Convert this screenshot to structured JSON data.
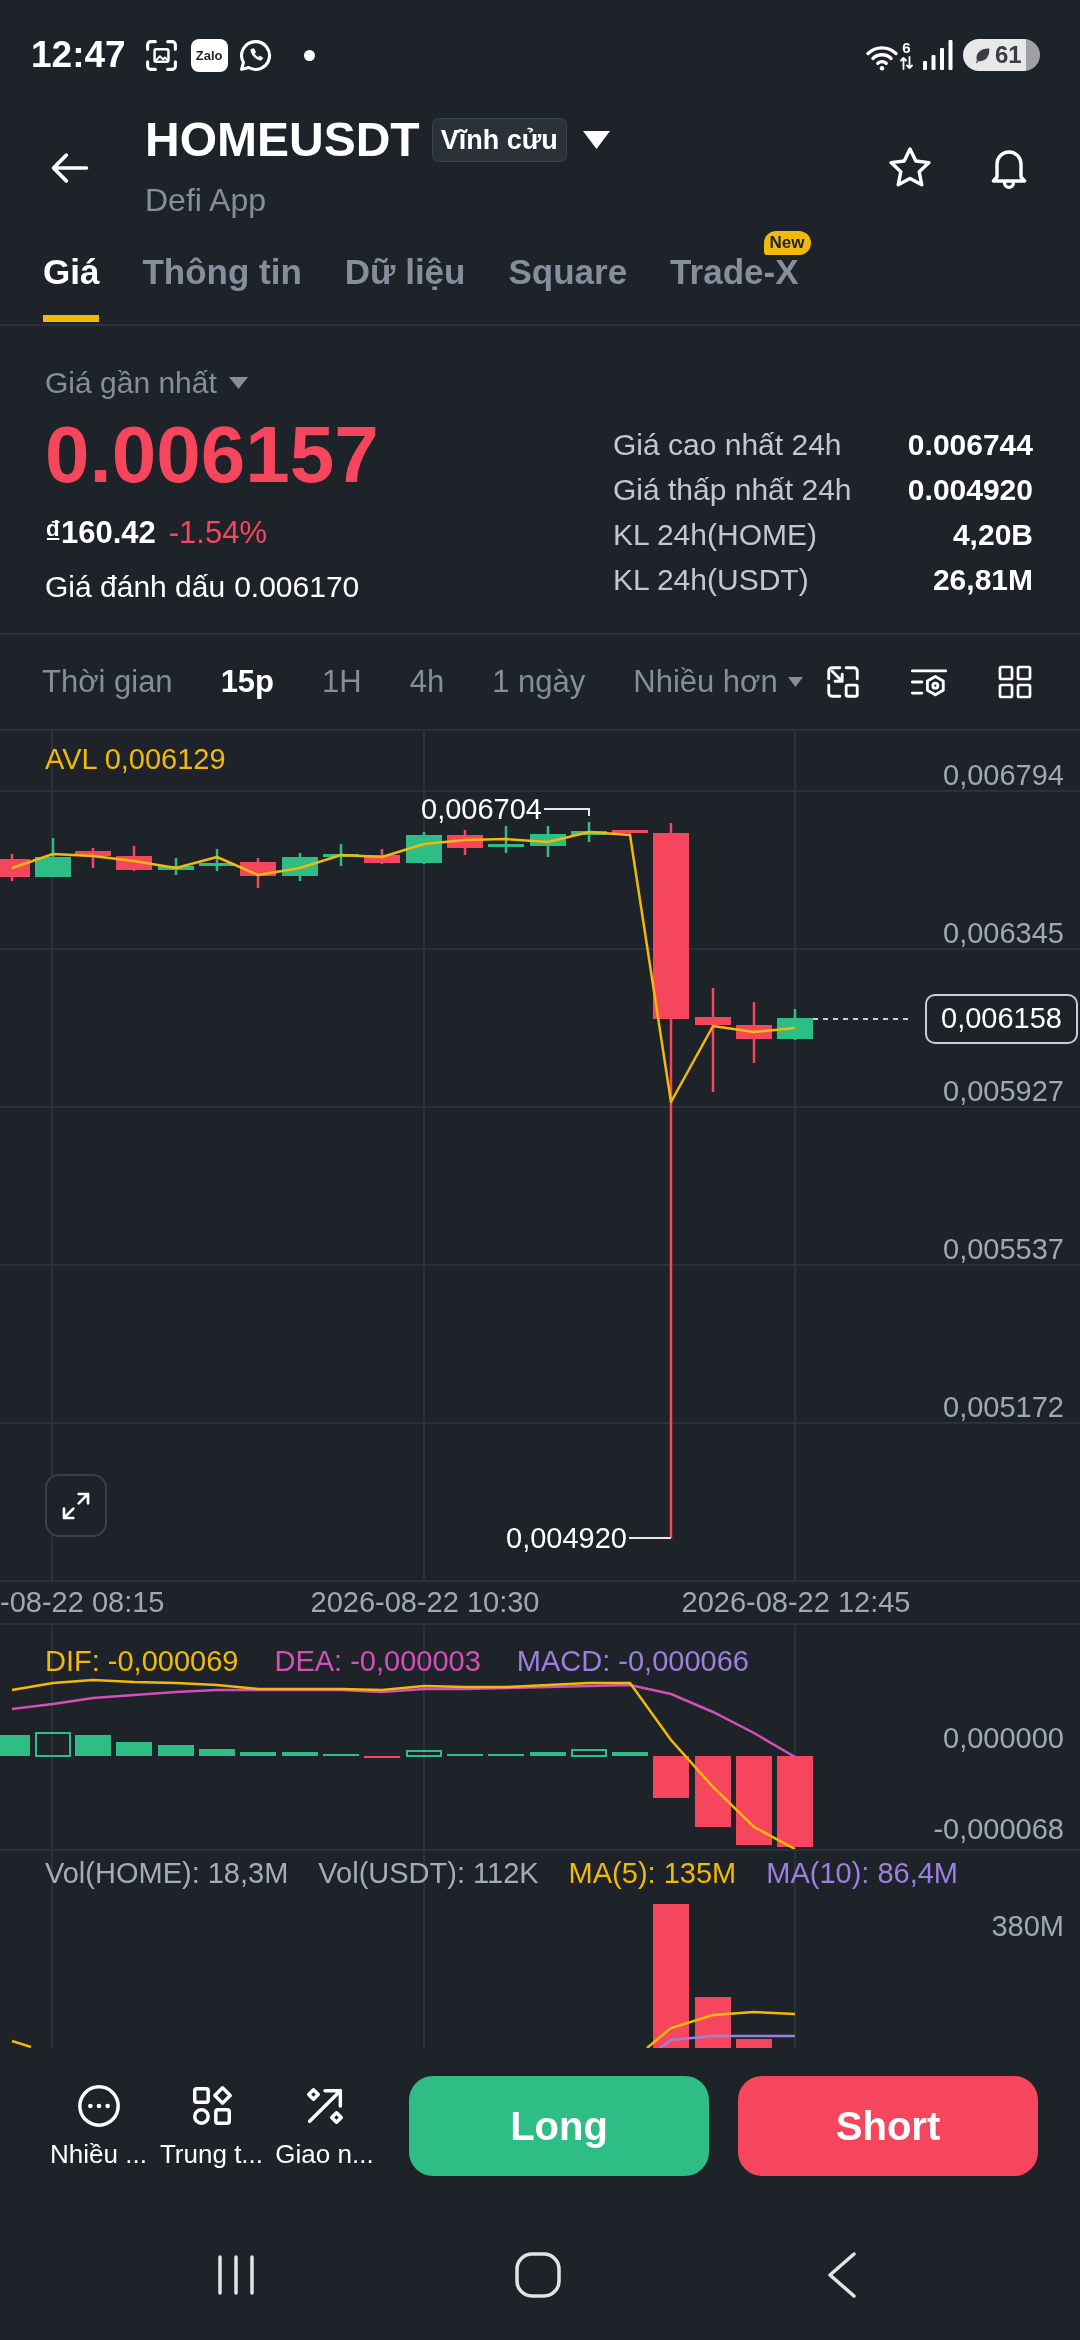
{
  "status_bar": {
    "time": "12:47",
    "app_badge": "Zalo",
    "network_type": "6",
    "battery": "61"
  },
  "header": {
    "symbol": "HOMEUSDT",
    "contract_type": "Vĩnh cửu",
    "subtitle": "Defi App"
  },
  "tabs": [
    {
      "label": "Giá",
      "selected": true
    },
    {
      "label": "Thông tin",
      "selected": false
    },
    {
      "label": "Dữ liệu",
      "selected": false
    },
    {
      "label": "Square",
      "selected": false
    },
    {
      "label": "Trade-X",
      "selected": false,
      "badge": "New"
    }
  ],
  "price": {
    "label": "Giá gần nhất",
    "last": "0.006157",
    "fiat": "₫160.42",
    "change": "-1.54%",
    "mark_label": "Giá đánh dấu",
    "mark": "0.006170"
  },
  "stats": [
    {
      "label": "Giá cao nhất 24h",
      "value": "0.006744"
    },
    {
      "label": "Giá thấp nhất 24h",
      "value": "0.004920"
    },
    {
      "label": "KL 24h(HOME)",
      "value": "4,20B"
    },
    {
      "label": "KL 24h(USDT)",
      "value": "26,81M"
    }
  ],
  "intervals": [
    {
      "label": "Thời gian",
      "selected": false
    },
    {
      "label": "15p",
      "selected": true
    },
    {
      "label": "1H",
      "selected": false
    },
    {
      "label": "4h",
      "selected": false
    },
    {
      "label": "1 ngày",
      "selected": false
    }
  ],
  "more_menu": "Nhiều hơn",
  "chart": {
    "indicator": "AVL 0,006129",
    "y_labels": [
      "0,006794",
      "0,006345",
      "0,005927",
      "0,005537",
      "0,005172"
    ],
    "high_label": "0,006704",
    "low_label": "0,004920",
    "last_price": "0,006158",
    "x_labels": [
      "-08-22 08:15",
      "2026-08-22 10:30",
      "2026-08-22 12:45"
    ]
  },
  "macd": {
    "legend": [
      {
        "text": "DIF: -0,000069",
        "color": "#f0b90b"
      },
      {
        "text": "DEA: -0,000003",
        "color": "#d54fb8"
      },
      {
        "text": "MACD: -0,000066",
        "color": "#9d7fe0"
      }
    ],
    "y_labels": [
      "0,000000",
      "-0,000068"
    ]
  },
  "volume": {
    "legend": [
      {
        "text": "Vol(HOME): 18,3M",
        "color": "#a5acb6"
      },
      {
        "text": "Vol(USDT): 112K",
        "color": "#a5acb6"
      },
      {
        "text": "MA(5): 135M",
        "color": "#f0b90b"
      },
      {
        "text": "MA(10): 86,4M",
        "color": "#9d7fe0"
      }
    ],
    "y_label": "380M"
  },
  "actions": [
    {
      "label": "Nhiều ...",
      "kind": "more"
    },
    {
      "label": "Trung t...",
      "kind": "shapes"
    },
    {
      "label": "Giao n...",
      "kind": "trade"
    }
  ],
  "trade_buttons": [
    {
      "label": "Long",
      "kind": "long"
    },
    {
      "label": "Short",
      "kind": "short"
    }
  ]
}
